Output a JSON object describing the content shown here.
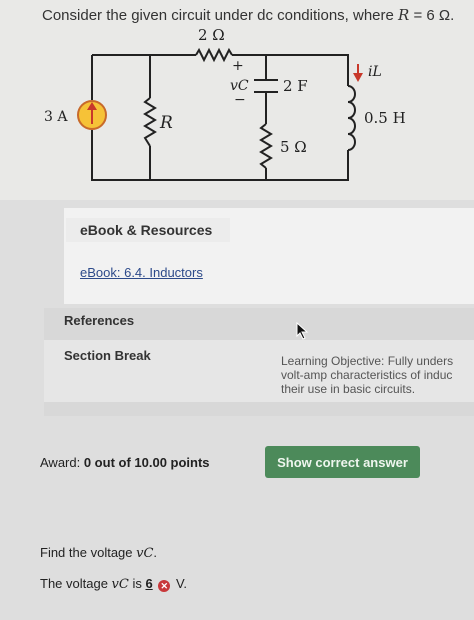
{
  "question": {
    "prefix": "Consider the given circuit under dc conditions, where ",
    "var": "R",
    "suffix": " = 6 Ω."
  },
  "circuit": {
    "r_top": "2 Ω",
    "current_source": "3 A",
    "resistor_r": "R",
    "cap_plus": "+",
    "cap_minus": "−",
    "cap_voltage": "vC",
    "capacitor": "2 F",
    "r_bottom": "5 Ω",
    "inductor_current": "iL",
    "inductor": "0.5 H"
  },
  "resources": {
    "heading": "eBook & Resources",
    "link": "eBook: 6.4. Inductors"
  },
  "references": {
    "heading": "References",
    "section_break": "Section Break",
    "learning_objective_lines": [
      "Learning Objective: Fully unders",
      "volt-amp characteristics of induc",
      "their use in basic circuits."
    ]
  },
  "award": {
    "label": "Award: ",
    "value": "0 out of 10.00 points"
  },
  "show_answer_label": "Show correct answer",
  "prompt": {
    "text": "Find the voltage ",
    "var": "vC",
    "end": "."
  },
  "answer": {
    "prefix": "The voltage ",
    "var": "vC",
    "mid": " is ",
    "value": "6",
    "unit": " V."
  }
}
